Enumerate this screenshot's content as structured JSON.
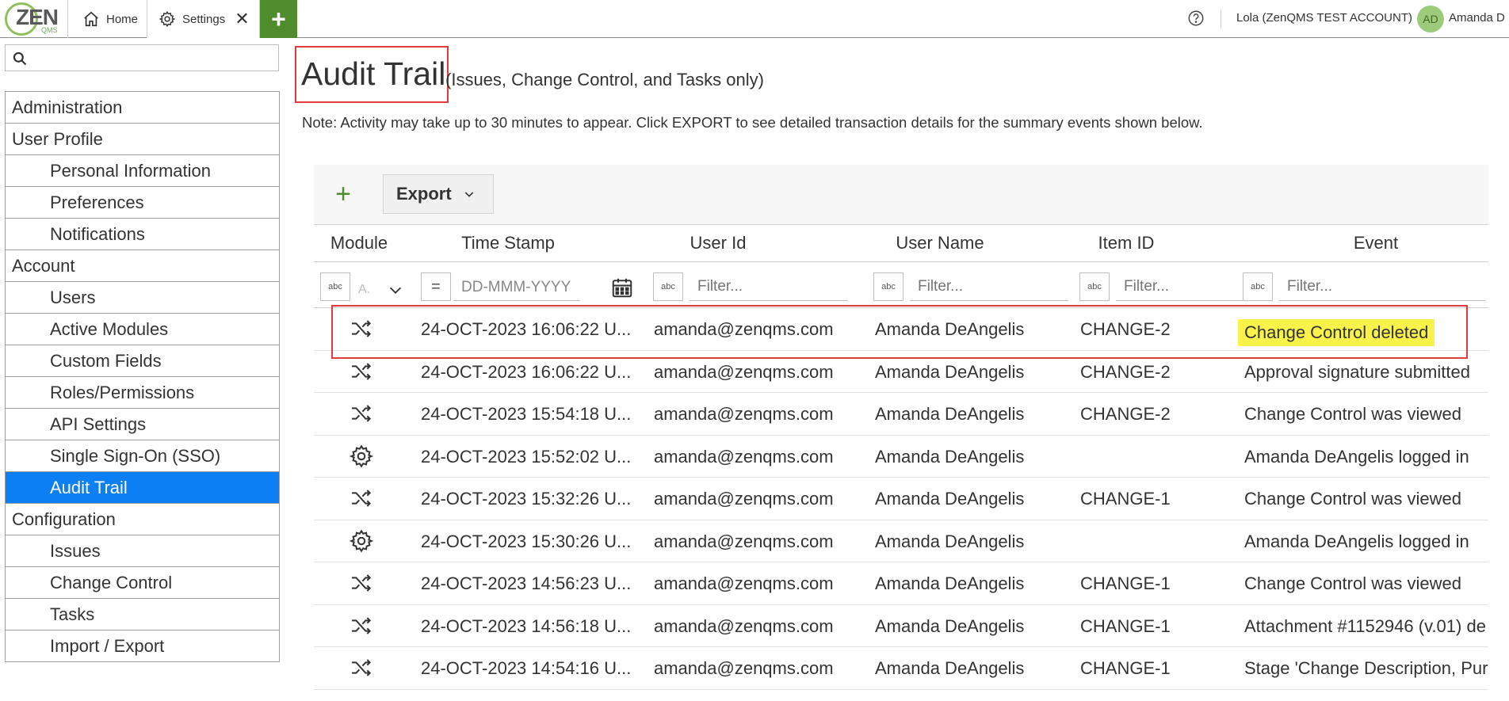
{
  "topbar": {
    "logo_text": "ZEN",
    "logo_sub": "QMS",
    "tabs": [
      {
        "label": "Home"
      },
      {
        "label": "Settings"
      }
    ],
    "account": "Lola (ZenQMS TEST ACCOUNT)",
    "avatar_initials": "AD",
    "user_short": "Amanda D",
    "colors": {
      "brand_green": "#4f8c2b",
      "logo_ring": "#8fc060",
      "accent_blue": "#0d7ff5",
      "highlight_red": "#e23b3b"
    }
  },
  "sidebar": {
    "search_placeholder": "",
    "items": [
      {
        "label": "Administration",
        "type": "section"
      },
      {
        "label": "User Profile",
        "type": "section"
      },
      {
        "label": "Personal Information",
        "type": "child"
      },
      {
        "label": "Preferences",
        "type": "child"
      },
      {
        "label": "Notifications",
        "type": "child"
      },
      {
        "label": "Account",
        "type": "section"
      },
      {
        "label": "Users",
        "type": "child"
      },
      {
        "label": "Active Modules",
        "type": "child"
      },
      {
        "label": "Custom Fields",
        "type": "child"
      },
      {
        "label": "Roles/Permissions",
        "type": "child"
      },
      {
        "label": "API Settings",
        "type": "child"
      },
      {
        "label": "Single Sign-On (SSO)",
        "type": "child"
      },
      {
        "label": "Audit Trail",
        "type": "child",
        "active": true
      },
      {
        "label": "Configuration",
        "type": "section"
      },
      {
        "label": "Issues",
        "type": "child"
      },
      {
        "label": "Change Control",
        "type": "child"
      },
      {
        "label": "Tasks",
        "type": "child"
      },
      {
        "label": "Import / Export",
        "type": "child"
      }
    ]
  },
  "main": {
    "title": "Audit Trail",
    "subtitle": "(Issues, Change Control, and Tasks only)",
    "note": "Note: Activity may take up to 30 minutes to appear. Click EXPORT to see detailed transaction details for the summary events shown below.",
    "export_label": "Export",
    "columns": [
      "Module",
      "Time Stamp",
      "User Id",
      "User Name",
      "Item ID",
      "Event"
    ],
    "filters": {
      "module_text": "A.",
      "date_placeholder": "DD-MMM-YYYY",
      "text_placeholder": "Filter...",
      "op_text": "abc",
      "op_equals": "="
    },
    "rows": [
      {
        "module": "shuffle-icon",
        "timestamp": "24-OCT-2023 16:06:22 U...",
        "user_id": "amanda@zenqms.com",
        "user_name": "Amanda DeAngelis",
        "item_id": "CHANGE-2",
        "event": "Change Control deleted",
        "highlight": true
      },
      {
        "module": "shuffle-icon",
        "timestamp": "24-OCT-2023 16:06:22 U...",
        "user_id": "amanda@zenqms.com",
        "user_name": "Amanda DeAngelis",
        "item_id": "CHANGE-2",
        "event": "Approval signature submitted"
      },
      {
        "module": "shuffle-icon",
        "timestamp": "24-OCT-2023 15:54:18 U...",
        "user_id": "amanda@zenqms.com",
        "user_name": "Amanda DeAngelis",
        "item_id": "CHANGE-2",
        "event": "Change Control was viewed"
      },
      {
        "module": "gear-icon",
        "timestamp": "24-OCT-2023 15:52:02 U...",
        "user_id": "amanda@zenqms.com",
        "user_name": "Amanda DeAngelis",
        "item_id": "",
        "event": "Amanda DeAngelis logged in"
      },
      {
        "module": "shuffle-icon",
        "timestamp": "24-OCT-2023 15:32:26 U...",
        "user_id": "amanda@zenqms.com",
        "user_name": "Amanda DeAngelis",
        "item_id": "CHANGE-1",
        "event": "Change Control was viewed"
      },
      {
        "module": "gear-icon",
        "timestamp": "24-OCT-2023 15:30:26 U...",
        "user_id": "amanda@zenqms.com",
        "user_name": "Amanda DeAngelis",
        "item_id": "",
        "event": "Amanda DeAngelis logged in"
      },
      {
        "module": "shuffle-icon",
        "timestamp": "24-OCT-2023 14:56:23 U...",
        "user_id": "amanda@zenqms.com",
        "user_name": "Amanda DeAngelis",
        "item_id": "CHANGE-1",
        "event": "Change Control was viewed"
      },
      {
        "module": "shuffle-icon",
        "timestamp": "24-OCT-2023 14:56:18 U...",
        "user_id": "amanda@zenqms.com",
        "user_name": "Amanda DeAngelis",
        "item_id": "CHANGE-1",
        "event": "Attachment #1152946 (v.01) de"
      },
      {
        "module": "shuffle-icon",
        "timestamp": "24-OCT-2023 14:54:16 U...",
        "user_id": "amanda@zenqms.com",
        "user_name": "Amanda DeAngelis",
        "item_id": "CHANGE-1",
        "event": "Stage 'Change Description, Purp"
      }
    ]
  }
}
